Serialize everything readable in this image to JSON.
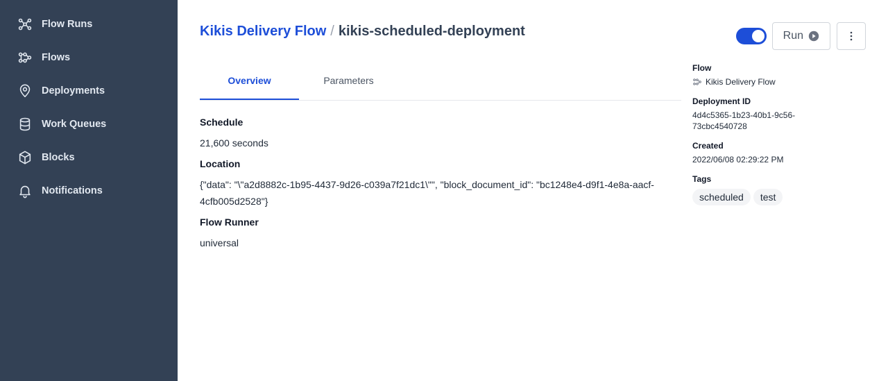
{
  "sidebar": {
    "items": [
      {
        "label": "Flow Runs",
        "icon": "flow-runs-icon"
      },
      {
        "label": "Flows",
        "icon": "flows-icon"
      },
      {
        "label": "Deployments",
        "icon": "location-pin-icon"
      },
      {
        "label": "Work Queues",
        "icon": "database-icon"
      },
      {
        "label": "Blocks",
        "icon": "cube-icon"
      },
      {
        "label": "Notifications",
        "icon": "bell-icon"
      }
    ]
  },
  "header": {
    "flow_link": "Kikis Delivery Flow",
    "separator": "/",
    "deployment_name": "kikis-scheduled-deployment"
  },
  "actions": {
    "toggle_on": true,
    "run_label": "Run"
  },
  "tabs": [
    {
      "label": "Overview",
      "active": true
    },
    {
      "label": "Parameters",
      "active": false
    }
  ],
  "overview": {
    "schedule_label": "Schedule",
    "schedule_value": "21,600 seconds",
    "location_label": "Location",
    "location_value": "{\"data\": \"\\\"a2d8882c-1b95-4437-9d26-c039a7f21dc1\\\"\", \"block_document_id\": \"bc1248e4-d9f1-4e8a-aacf-4cfb005d2528\"}",
    "flow_runner_label": "Flow Runner",
    "flow_runner_value": "universal"
  },
  "details": {
    "flow_label": "Flow",
    "flow_value": "Kikis Delivery Flow",
    "deployment_id_label": "Deployment ID",
    "deployment_id_value": "4d4c5365-1b23-40b1-9c56-73cbc4540728",
    "created_label": "Created",
    "created_value": "2022/06/08 02:29:22 PM",
    "tags_label": "Tags",
    "tags": [
      "scheduled",
      "test"
    ]
  },
  "colors": {
    "sidebar_bg": "#334155",
    "accent": "#1d4ed8"
  }
}
